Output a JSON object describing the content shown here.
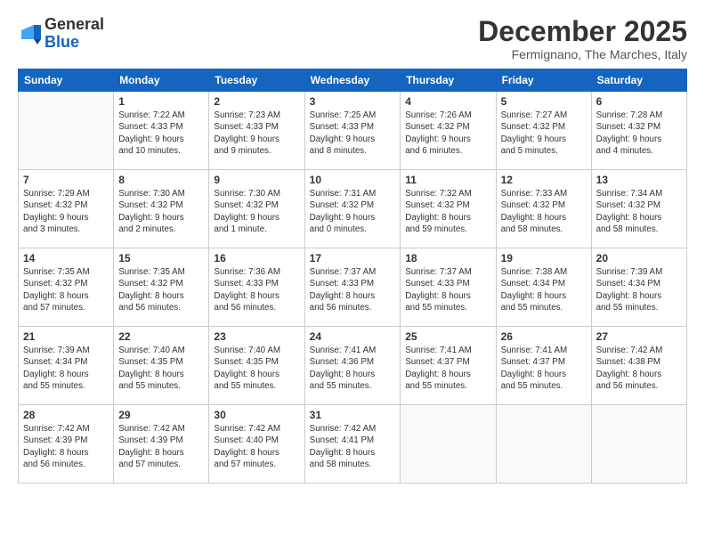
{
  "header": {
    "logo_line1": "General",
    "logo_line2": "Blue",
    "month_title": "December 2025",
    "location": "Fermignano, The Marches, Italy"
  },
  "weekdays": [
    "Sunday",
    "Monday",
    "Tuesday",
    "Wednesday",
    "Thursday",
    "Friday",
    "Saturday"
  ],
  "weeks": [
    [
      {
        "day": "",
        "info": ""
      },
      {
        "day": "1",
        "info": "Sunrise: 7:22 AM\nSunset: 4:33 PM\nDaylight: 9 hours\nand 10 minutes."
      },
      {
        "day": "2",
        "info": "Sunrise: 7:23 AM\nSunset: 4:33 PM\nDaylight: 9 hours\nand 9 minutes."
      },
      {
        "day": "3",
        "info": "Sunrise: 7:25 AM\nSunset: 4:33 PM\nDaylight: 9 hours\nand 8 minutes."
      },
      {
        "day": "4",
        "info": "Sunrise: 7:26 AM\nSunset: 4:32 PM\nDaylight: 9 hours\nand 6 minutes."
      },
      {
        "day": "5",
        "info": "Sunrise: 7:27 AM\nSunset: 4:32 PM\nDaylight: 9 hours\nand 5 minutes."
      },
      {
        "day": "6",
        "info": "Sunrise: 7:28 AM\nSunset: 4:32 PM\nDaylight: 9 hours\nand 4 minutes."
      }
    ],
    [
      {
        "day": "7",
        "info": "Sunrise: 7:29 AM\nSunset: 4:32 PM\nDaylight: 9 hours\nand 3 minutes."
      },
      {
        "day": "8",
        "info": "Sunrise: 7:30 AM\nSunset: 4:32 PM\nDaylight: 9 hours\nand 2 minutes."
      },
      {
        "day": "9",
        "info": "Sunrise: 7:30 AM\nSunset: 4:32 PM\nDaylight: 9 hours\nand 1 minute."
      },
      {
        "day": "10",
        "info": "Sunrise: 7:31 AM\nSunset: 4:32 PM\nDaylight: 9 hours\nand 0 minutes."
      },
      {
        "day": "11",
        "info": "Sunrise: 7:32 AM\nSunset: 4:32 PM\nDaylight: 8 hours\nand 59 minutes."
      },
      {
        "day": "12",
        "info": "Sunrise: 7:33 AM\nSunset: 4:32 PM\nDaylight: 8 hours\nand 58 minutes."
      },
      {
        "day": "13",
        "info": "Sunrise: 7:34 AM\nSunset: 4:32 PM\nDaylight: 8 hours\nand 58 minutes."
      }
    ],
    [
      {
        "day": "14",
        "info": "Sunrise: 7:35 AM\nSunset: 4:32 PM\nDaylight: 8 hours\nand 57 minutes."
      },
      {
        "day": "15",
        "info": "Sunrise: 7:35 AM\nSunset: 4:32 PM\nDaylight: 8 hours\nand 56 minutes."
      },
      {
        "day": "16",
        "info": "Sunrise: 7:36 AM\nSunset: 4:33 PM\nDaylight: 8 hours\nand 56 minutes."
      },
      {
        "day": "17",
        "info": "Sunrise: 7:37 AM\nSunset: 4:33 PM\nDaylight: 8 hours\nand 56 minutes."
      },
      {
        "day": "18",
        "info": "Sunrise: 7:37 AM\nSunset: 4:33 PM\nDaylight: 8 hours\nand 55 minutes."
      },
      {
        "day": "19",
        "info": "Sunrise: 7:38 AM\nSunset: 4:34 PM\nDaylight: 8 hours\nand 55 minutes."
      },
      {
        "day": "20",
        "info": "Sunrise: 7:39 AM\nSunset: 4:34 PM\nDaylight: 8 hours\nand 55 minutes."
      }
    ],
    [
      {
        "day": "21",
        "info": "Sunrise: 7:39 AM\nSunset: 4:34 PM\nDaylight: 8 hours\nand 55 minutes."
      },
      {
        "day": "22",
        "info": "Sunrise: 7:40 AM\nSunset: 4:35 PM\nDaylight: 8 hours\nand 55 minutes."
      },
      {
        "day": "23",
        "info": "Sunrise: 7:40 AM\nSunset: 4:35 PM\nDaylight: 8 hours\nand 55 minutes."
      },
      {
        "day": "24",
        "info": "Sunrise: 7:41 AM\nSunset: 4:36 PM\nDaylight: 8 hours\nand 55 minutes."
      },
      {
        "day": "25",
        "info": "Sunrise: 7:41 AM\nSunset: 4:37 PM\nDaylight: 8 hours\nand 55 minutes."
      },
      {
        "day": "26",
        "info": "Sunrise: 7:41 AM\nSunset: 4:37 PM\nDaylight: 8 hours\nand 55 minutes."
      },
      {
        "day": "27",
        "info": "Sunrise: 7:42 AM\nSunset: 4:38 PM\nDaylight: 8 hours\nand 56 minutes."
      }
    ],
    [
      {
        "day": "28",
        "info": "Sunrise: 7:42 AM\nSunset: 4:39 PM\nDaylight: 8 hours\nand 56 minutes."
      },
      {
        "day": "29",
        "info": "Sunrise: 7:42 AM\nSunset: 4:39 PM\nDaylight: 8 hours\nand 57 minutes."
      },
      {
        "day": "30",
        "info": "Sunrise: 7:42 AM\nSunset: 4:40 PM\nDaylight: 8 hours\nand 57 minutes."
      },
      {
        "day": "31",
        "info": "Sunrise: 7:42 AM\nSunset: 4:41 PM\nDaylight: 8 hours\nand 58 minutes."
      },
      {
        "day": "",
        "info": ""
      },
      {
        "day": "",
        "info": ""
      },
      {
        "day": "",
        "info": ""
      }
    ]
  ]
}
